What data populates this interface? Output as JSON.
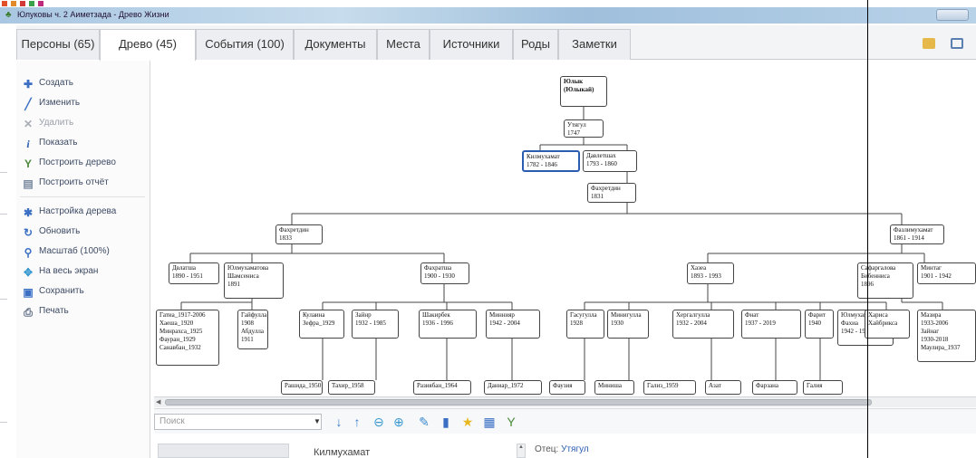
{
  "window": {
    "title": "Юлуковы ч. 2 Аиметзада - Древо Жизни"
  },
  "tabs": [
    {
      "label": "Персоны (65)",
      "active": false
    },
    {
      "label": "Древо (45)",
      "active": true
    },
    {
      "label": "События (100)",
      "active": false
    },
    {
      "label": "Документы",
      "active": false
    },
    {
      "label": "Места",
      "active": false
    },
    {
      "label": "Источники",
      "active": false
    },
    {
      "label": "Роды",
      "active": false
    },
    {
      "label": "Заметки",
      "active": false
    }
  ],
  "sidebar": {
    "items": [
      {
        "label": "Создать",
        "icon": "plus-icon",
        "enabled": true
      },
      {
        "label": "Изменить",
        "icon": "pencil-icon",
        "enabled": true
      },
      {
        "label": "Удалить",
        "icon": "delete-icon",
        "enabled": false
      },
      {
        "label": "Показать",
        "icon": "info-icon",
        "enabled": true
      },
      {
        "label": "Построить дерево",
        "icon": "tree-icon",
        "enabled": true
      },
      {
        "label": "Построить отчёт",
        "icon": "report-icon",
        "enabled": true
      },
      {
        "label": "Настройка дерева",
        "icon": "gear-icon",
        "enabled": true
      },
      {
        "label": "Обновить",
        "icon": "refresh-icon",
        "enabled": true
      },
      {
        "label": "Масштаб (100%)",
        "icon": "zoom-icon",
        "enabled": true
      },
      {
        "label": "На весь экран",
        "icon": "fullscreen-icon",
        "enabled": true
      },
      {
        "label": "Сохранить",
        "icon": "save-icon",
        "enabled": true
      },
      {
        "label": "Печать",
        "icon": "print-icon",
        "enabled": true
      }
    ]
  },
  "tree": {
    "nodes": [
      {
        "id": "n1",
        "text": "Юлык\n(Юлыкай)",
        "bold": true
      },
      {
        "id": "n2",
        "text": "Утягул\n1747"
      },
      {
        "id": "n3",
        "text": "Килмухамат\n1782 - 1846",
        "selected": true
      },
      {
        "id": "n4",
        "text": "Давлетшах\n1793 - 1860"
      },
      {
        "id": "n5",
        "text": "Фахретдин\n1831"
      },
      {
        "id": "n6",
        "text": "Фахретдин\n1833"
      },
      {
        "id": "n7",
        "text": "Фазлимухамат\n1861 - 1914"
      },
      {
        "id": "n8",
        "text": "Двлатша\n1890 - 1951"
      },
      {
        "id": "n9",
        "text": "Юлмухаматова\nШамсениса\n1891"
      },
      {
        "id": "n10",
        "text": "Фахратша\n1900 - 1930"
      },
      {
        "id": "n11",
        "text": "Хазеа\n1893 - 1993"
      },
      {
        "id": "n12",
        "text": "Сафаргалова\nБибенниса\n1896"
      },
      {
        "id": "n13",
        "text": "Минтаг\n1901 - 1942"
      },
      {
        "id": "n14",
        "text": "Гатиа_1917-2006\nХаеша_1920\nМинрахса_1925\nФауран_1929\nСанавбан_1932"
      },
      {
        "id": "n15",
        "text": "Гайфулла\n1908\nАбдулла\n1911"
      },
      {
        "id": "n16",
        "text": "Кулаина\nЗефра_1929"
      },
      {
        "id": "n17",
        "text": "Зайнр\n1932 - 1985"
      },
      {
        "id": "n18",
        "text": "Шакирбек\n1936 - 1996"
      },
      {
        "id": "n19",
        "text": "Миннияр\n1942 - 2004"
      },
      {
        "id": "n20",
        "text": "Гасугулла\n1928"
      },
      {
        "id": "n21",
        "text": "Минигулла\n1930"
      },
      {
        "id": "n22",
        "text": "Хергалгулла\n1932 - 2004"
      },
      {
        "id": "n23",
        "text": "Фнат\n1937 - 2019"
      },
      {
        "id": "n24",
        "text": "Фарит\n1940"
      },
      {
        "id": "n25",
        "text": "Юлмухаматова\nФахиа\n1942 - 1982"
      },
      {
        "id": "n26",
        "text": "Хариса\nХайбрикса"
      },
      {
        "id": "n27",
        "text": "Мазира\n1933-2006\nЗайнаг\n1930-2018\nМаулира_1937"
      },
      {
        "id": "n28",
        "text": "Рашида_1950"
      },
      {
        "id": "n29",
        "text": "Тахир_1958"
      },
      {
        "id": "n30",
        "text": "Разиябан_1964"
      },
      {
        "id": "n31",
        "text": "Даниар_1972"
      },
      {
        "id": "n32",
        "text": "Фаузия"
      },
      {
        "id": "n33",
        "text": "Миниша"
      },
      {
        "id": "n34",
        "text": "Гализ_1959"
      },
      {
        "id": "n35",
        "text": "Азат"
      },
      {
        "id": "n36",
        "text": "Фарзана"
      },
      {
        "id": "n37",
        "text": "Галия"
      }
    ]
  },
  "search": {
    "placeholder": "Поиск"
  },
  "details": {
    "name": "Килмухамат",
    "father_label": "Отец:",
    "father_value": "Утягул"
  },
  "colors": {
    "selected_border": "#2a5db0",
    "link": "#2a5db0"
  }
}
